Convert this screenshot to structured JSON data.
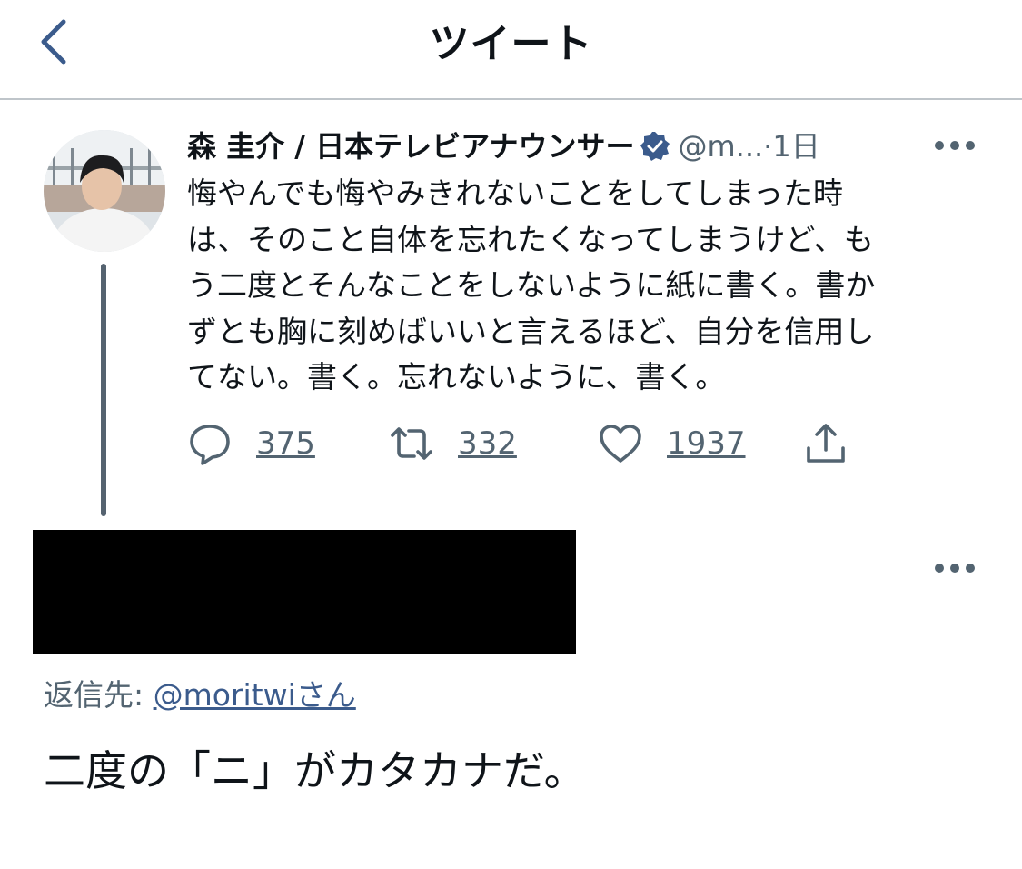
{
  "header": {
    "title": "ツイート",
    "back_icon": "chevron-left-icon"
  },
  "tweet": {
    "author_name": "森 圭介 / 日本テレビアナウンサー",
    "handle": "@m...",
    "separator": "·",
    "time": "1日",
    "verified_icon": "verified-badge-icon",
    "text": "悔やんでも悔やみきれないことをしてしまった時\nは、そのこと自体を忘れたくなってしまうけど、も\nう二度とそんなことをしないように紙に書く。書か\nずとも胸に刻めばいいと言えるほど、自分を信用し\nてない。書く。忘れないように、書く。",
    "replies": "375",
    "retweets": "332",
    "likes": "1937"
  },
  "reply": {
    "reply_prefix": "返信先: ",
    "reply_handle": "@moritwiさん",
    "text": "二度の「ニ」がカタカナだ。"
  },
  "colors": {
    "text": "#0f1419",
    "secondary": "#536471",
    "verified": "#3b5b8c",
    "thread_line": "#556370",
    "divider": "#bfc5ca",
    "redaction": "#000000"
  }
}
